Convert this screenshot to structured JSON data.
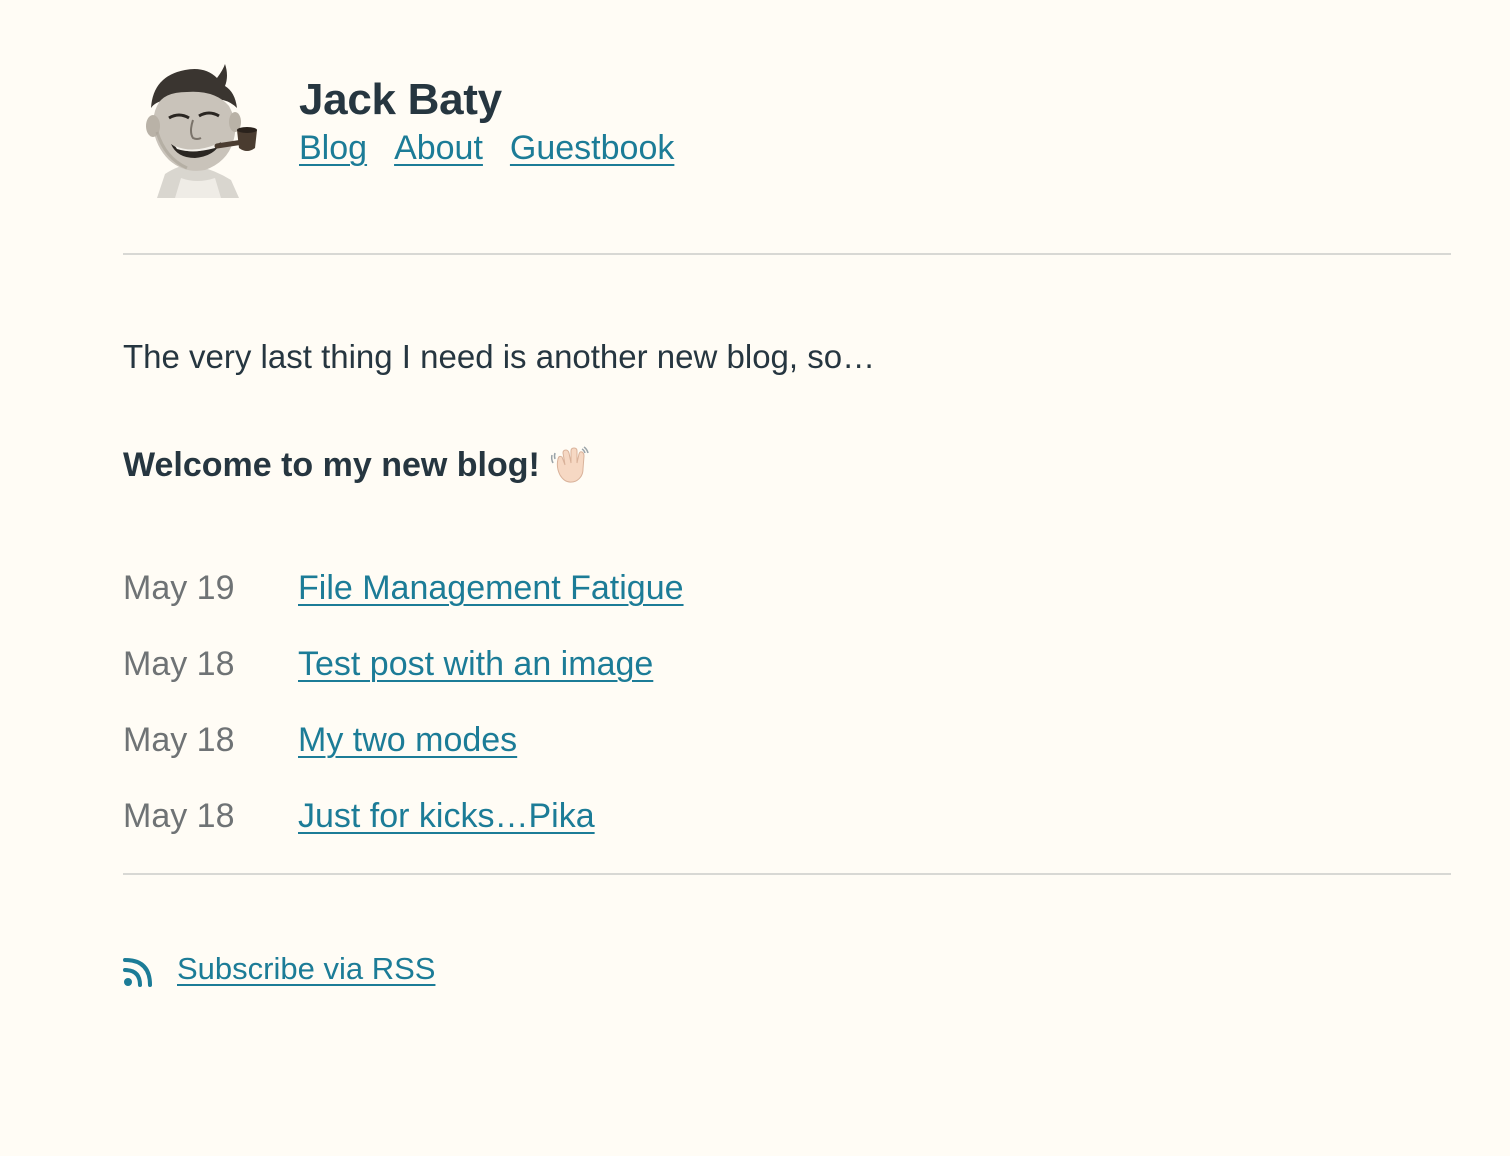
{
  "site": {
    "title": "Jack Baty",
    "nav": [
      {
        "label": "Blog"
      },
      {
        "label": "About"
      },
      {
        "label": "Guestbook"
      }
    ]
  },
  "main": {
    "intro": "The very last thing I need is another new blog, so…",
    "welcome": "Welcome to my new blog!",
    "posts": [
      {
        "date": "May 19",
        "title": "File Management Fatigue"
      },
      {
        "date": "May 18",
        "title": "Test post with an image"
      },
      {
        "date": "May 18",
        "title": "My two modes"
      },
      {
        "date": "May 18",
        "title": "Just for kicks…Pika"
      }
    ]
  },
  "footer": {
    "rss_icon": "rss-icon",
    "rss_label": "Subscribe via RSS"
  },
  "colors": {
    "background": "#fffcf5",
    "text": "#263640",
    "link": "#1c7c97",
    "muted": "#6f7375"
  }
}
